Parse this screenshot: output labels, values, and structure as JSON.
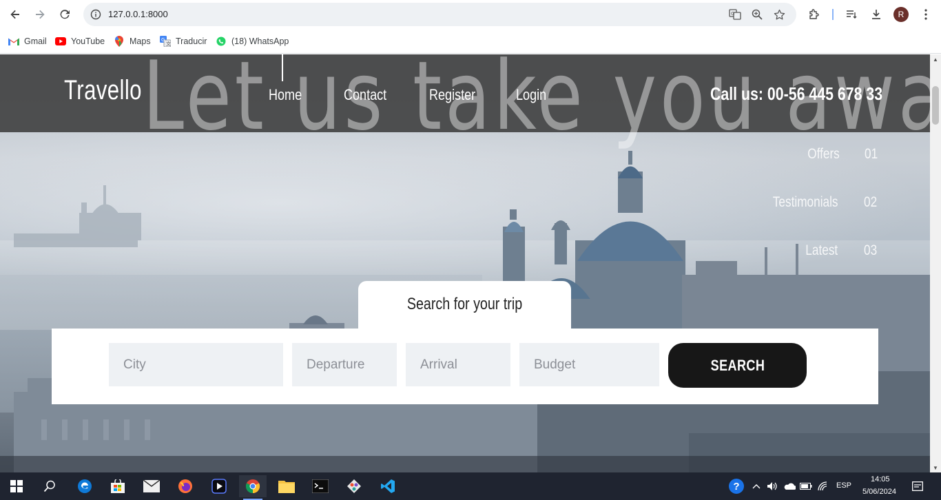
{
  "browser": {
    "url": "127.0.0.1:8000",
    "bookmarks": [
      {
        "label": "Gmail",
        "icon": "gmail-icon"
      },
      {
        "label": "YouTube",
        "icon": "youtube-icon"
      },
      {
        "label": "Maps",
        "icon": "maps-icon"
      },
      {
        "label": "Traducir",
        "icon": "translate-icon"
      },
      {
        "label": "(18) WhatsApp",
        "icon": "whatsapp-icon"
      }
    ],
    "profile_initial": "R"
  },
  "site": {
    "logo": "Travello",
    "watermark": "Let us take you away",
    "menu": [
      "Home",
      "Contact",
      "Register",
      "Login"
    ],
    "active_menu": "Home",
    "phone": "Call us: 00-56 445 678 33",
    "side_nav": [
      {
        "label": "Offers",
        "num": "01"
      },
      {
        "label": "Testimonials",
        "num": "02"
      },
      {
        "label": "Latest",
        "num": "03"
      }
    ],
    "search": {
      "title": "Search for your trip",
      "city_placeholder": "City",
      "departure_placeholder": "Departure",
      "arrival_placeholder": "Arrival",
      "budget_placeholder": "Budget",
      "button": "SEARCH"
    }
  },
  "taskbar": {
    "apps": [
      "windows-start",
      "search",
      "edge",
      "store",
      "mail",
      "firefox",
      "media-player",
      "chrome",
      "file-explorer",
      "terminal",
      "git",
      "vscode"
    ],
    "active_app": "chrome",
    "language": "ESP",
    "time": "14:05",
    "date": "5/06/2024"
  },
  "colors": {
    "header_bg": "#3c3c3c",
    "search_button": "#171717",
    "field_bg": "#eef1f4",
    "taskbar_bg": "#1f2430"
  }
}
